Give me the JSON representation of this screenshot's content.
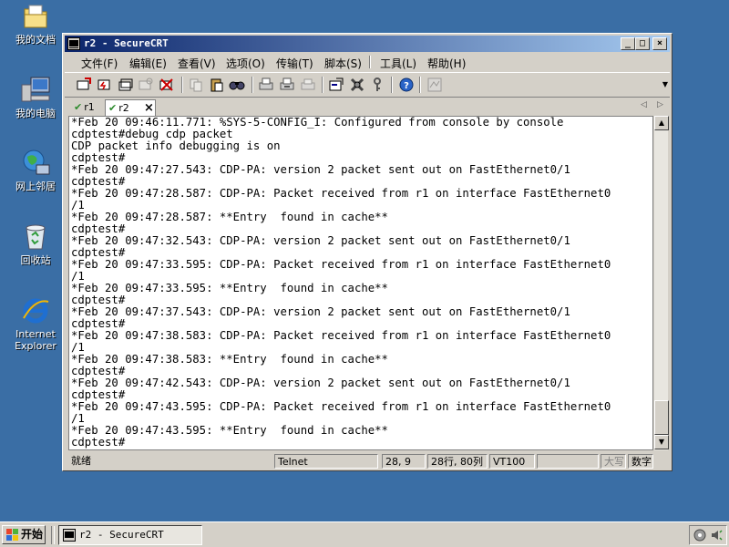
{
  "desktop": {
    "icons": [
      {
        "label": "我的文档"
      },
      {
        "label": "我的电脑"
      },
      {
        "label": "网上邻居"
      },
      {
        "label": "回收站"
      },
      {
        "label": "Internet Explorer"
      }
    ]
  },
  "window": {
    "title": "r2 - SecureCRT",
    "controls": {
      "minimize": "_",
      "maximize": "□",
      "close": "×"
    }
  },
  "menu": {
    "items": [
      "文件(F)",
      "编辑(E)",
      "查看(V)",
      "选项(O)",
      "传输(T)",
      "脚本(S)",
      "工具(L)",
      "帮助(H)"
    ]
  },
  "toolbar": {
    "icons": [
      "connect-icon",
      "quick-connect-icon",
      "connect-tab-icon",
      "reconnect-icon",
      "disconnect-icon",
      "copy-icon",
      "paste-icon",
      "find-icon",
      "print-icon",
      "print-selection-icon",
      "print-setup-icon",
      "session-options-icon",
      "global-options-icon",
      "key-icon",
      "help-icon",
      "map-icon"
    ]
  },
  "tabs": [
    {
      "label": "r1",
      "active": false
    },
    {
      "label": "r2",
      "active": true,
      "close": "×"
    }
  ],
  "terminal": {
    "lines": [
      "*Feb 20 09:46:11.771: %SYS-5-CONFIG_I: Configured from console by console",
      "cdptest#debug cdp packet",
      "CDP packet info debugging is on",
      "cdptest#",
      "*Feb 20 09:47:27.543: CDP-PA: version 2 packet sent out on FastEthernet0/1",
      "cdptest#",
      "*Feb 20 09:47:28.587: CDP-PA: Packet received from r1 on interface FastEthernet0",
      "/1",
      "*Feb 20 09:47:28.587: **Entry  found in cache**",
      "cdptest#",
      "*Feb 20 09:47:32.543: CDP-PA: version 2 packet sent out on FastEthernet0/1",
      "cdptest#",
      "*Feb 20 09:47:33.595: CDP-PA: Packet received from r1 on interface FastEthernet0",
      "/1",
      "*Feb 20 09:47:33.595: **Entry  found in cache**",
      "cdptest#",
      "*Feb 20 09:47:37.543: CDP-PA: version 2 packet sent out on FastEthernet0/1",
      "cdptest#",
      "*Feb 20 09:47:38.583: CDP-PA: Packet received from r1 on interface FastEthernet0",
      "/1",
      "*Feb 20 09:47:38.583: **Entry  found in cache**",
      "cdptest#",
      "*Feb 20 09:47:42.543: CDP-PA: version 2 packet sent out on FastEthernet0/1",
      "cdptest#",
      "*Feb 20 09:47:43.595: CDP-PA: Packet received from r1 on interface FastEthernet0",
      "/1",
      "*Feb 20 09:47:43.595: **Entry  found in cache**",
      "cdptest#"
    ]
  },
  "status": {
    "ready": "就绪",
    "protocol": "Telnet",
    "cursor": "28,  9",
    "size": "28行, 80列",
    "emulation": "VT100",
    "caps": "大写",
    "num": "数字"
  },
  "taskbar": {
    "start": "开始",
    "task": "r2 - SecureCRT"
  }
}
